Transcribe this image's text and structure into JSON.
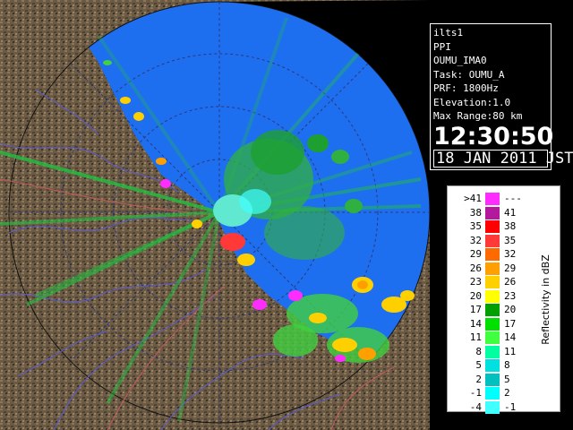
{
  "info": {
    "station": "ilts1",
    "mode": "PPI",
    "radar_id": "OUMU_IMA0",
    "task": "Task: OUMU_A",
    "prf": "PRF: 1800Hz",
    "elevation": "Elevation:1.0",
    "max_range": "Max Range:80 km",
    "time": "12:30:50",
    "date": "18 JAN 2011 JST"
  },
  "legend": {
    "unit": "Reflectivity in dBZ",
    "rows": [
      {
        "lo": ">41",
        "hi": "---",
        "color": "#ff2cff"
      },
      {
        "lo": "38",
        "hi": "41",
        "color": "#b4189c"
      },
      {
        "lo": "35",
        "hi": "38",
        "color": "#ff0000"
      },
      {
        "lo": "32",
        "hi": "35",
        "color": "#ff3838"
      },
      {
        "lo": "29",
        "hi": "32",
        "color": "#ff6a00"
      },
      {
        "lo": "26",
        "hi": "29",
        "color": "#ffa000"
      },
      {
        "lo": "23",
        "hi": "26",
        "color": "#ffd000"
      },
      {
        "lo": "20",
        "hi": "23",
        "color": "#ffff00"
      },
      {
        "lo": "17",
        "hi": "20",
        "color": "#00a000"
      },
      {
        "lo": "14",
        "hi": "17",
        "color": "#00e000"
      },
      {
        "lo": "11",
        "hi": "14",
        "color": "#40ff40"
      },
      {
        "lo": "8",
        "hi": "11",
        "color": "#00ffa0"
      },
      {
        "lo": "5",
        "hi": "8",
        "color": "#00e0e0"
      },
      {
        "lo": "2",
        "hi": "5",
        "color": "#00c0c0"
      },
      {
        "lo": "-1",
        "hi": "2",
        "color": "#00ffff"
      },
      {
        "lo": "-4",
        "hi": "-1",
        "color": "#40ffff"
      }
    ]
  },
  "colors": {
    "sea": "#1e6ef0",
    "land": "#6b5a44",
    "range_ring": "#3a4a8a",
    "rivers": "#5a5ad0"
  }
}
